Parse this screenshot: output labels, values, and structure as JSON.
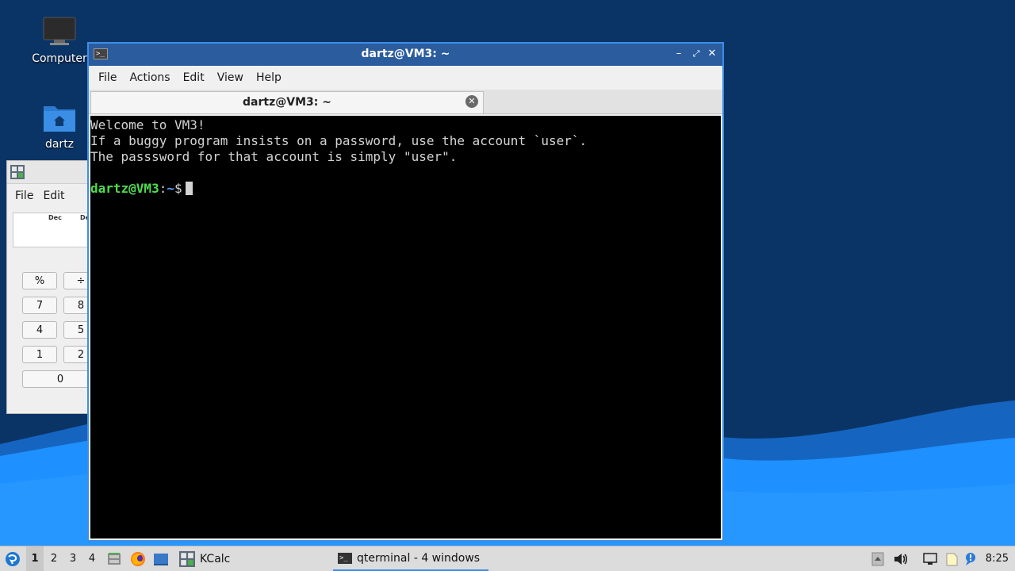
{
  "desktop": {
    "icons": [
      {
        "label": "Computer"
      },
      {
        "label": "dartz"
      }
    ]
  },
  "kcalc": {
    "menu": [
      "File",
      "Edit"
    ],
    "display_labels": [
      "Dec",
      "De"
    ],
    "buttons": [
      "%",
      "÷",
      "7",
      "8",
      "4",
      "5",
      "1",
      "2",
      "0"
    ]
  },
  "terminal": {
    "window_title": "dartz@VM3: ~",
    "menu": [
      "File",
      "Actions",
      "Edit",
      "View",
      "Help"
    ],
    "tab_title": "dartz@VM3: ~",
    "lines": [
      "Welcome to VM3!",
      "If a buggy program insists on a password, use the account `user`.",
      "The passsword for that account is simply \"user\"."
    ],
    "prompt": {
      "user_host": "dartz@VM3",
      "separator": ":",
      "path": "~",
      "symbol": "$"
    }
  },
  "taskbar": {
    "desktops": [
      "1",
      "2",
      "3",
      "4"
    ],
    "active_desktop": "1",
    "tasks": [
      {
        "label": "KCalc"
      },
      {
        "label": "qterminal - 4 windows"
      }
    ],
    "clock": "8:25"
  },
  "colors": {
    "desktop_bg": "#0b3466",
    "wave": "#1e90ff",
    "titlebar_active": "#2a5c9e",
    "window_border": "#3d8ee6",
    "prompt_user": "#4fdc4f",
    "prompt_path": "#5aa3ff"
  }
}
